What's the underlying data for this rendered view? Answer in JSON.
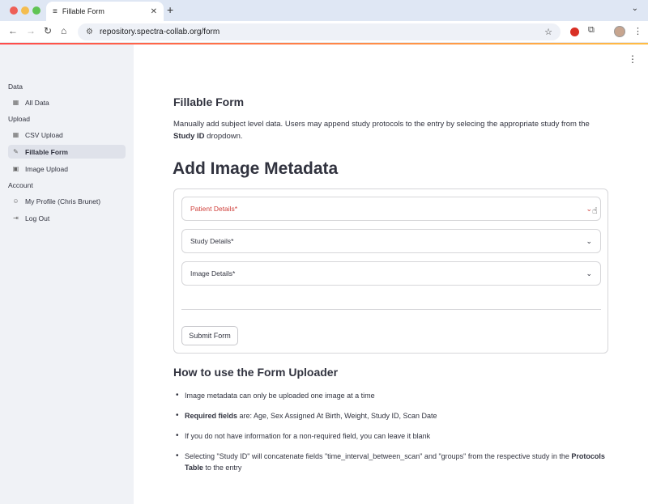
{
  "browser": {
    "tab_title": "Fillable Form",
    "url": "repository.spectra-collab.org/form"
  },
  "sidebar": {
    "sections": [
      {
        "title": "Data",
        "items": [
          {
            "label": "All Data",
            "icon": "table-icon"
          }
        ]
      },
      {
        "title": "Upload",
        "items": [
          {
            "label": "CSV Upload",
            "icon": "table-icon"
          },
          {
            "label": "Fillable Form",
            "icon": "edit-note-icon",
            "active": true
          },
          {
            "label": "Image Upload",
            "icon": "image-icon"
          }
        ]
      },
      {
        "title": "Account",
        "items": [
          {
            "label": "My Profile (Chris Brunet)",
            "icon": "person-icon"
          },
          {
            "label": "Log Out",
            "icon": "logout-icon"
          }
        ]
      }
    ]
  },
  "main": {
    "section_title": "Fillable Form",
    "intro_part1": "Manually add subject level data. Users may append study protocols to the entry by selecing the appropriate study from the ",
    "intro_bold": "Study ID",
    "intro_part2": " dropdown.",
    "heading": "Add Image Metadata",
    "expanders": [
      {
        "label": "Patient Details*"
      },
      {
        "label": "Study Details*"
      },
      {
        "label": "Image Details*"
      }
    ],
    "submit_label": "Submit Form",
    "howto_title": "How to use the Form Uploader",
    "bullets": {
      "b1": "Image metadata can only be uploaded one image at a time",
      "b2_bold": "Required fields",
      "b2_rest": " are: Age, Sex Assigned At Birth, Weight, Study ID, Scan Date",
      "b3": "If you do not have information for a non-required field, you can leave it blank",
      "b4_part1": "Selecting \"Study ID\" will concatenate fields \"time_interval_between_scan\" and \"groups\" from the respective study in the ",
      "b4_bold": "Protocols Table",
      "b4_part2": " to the entry"
    }
  },
  "colors": {
    "accent_red": "#d0403b",
    "sidebar_bg": "#f0f2f6",
    "text": "#31333f"
  }
}
